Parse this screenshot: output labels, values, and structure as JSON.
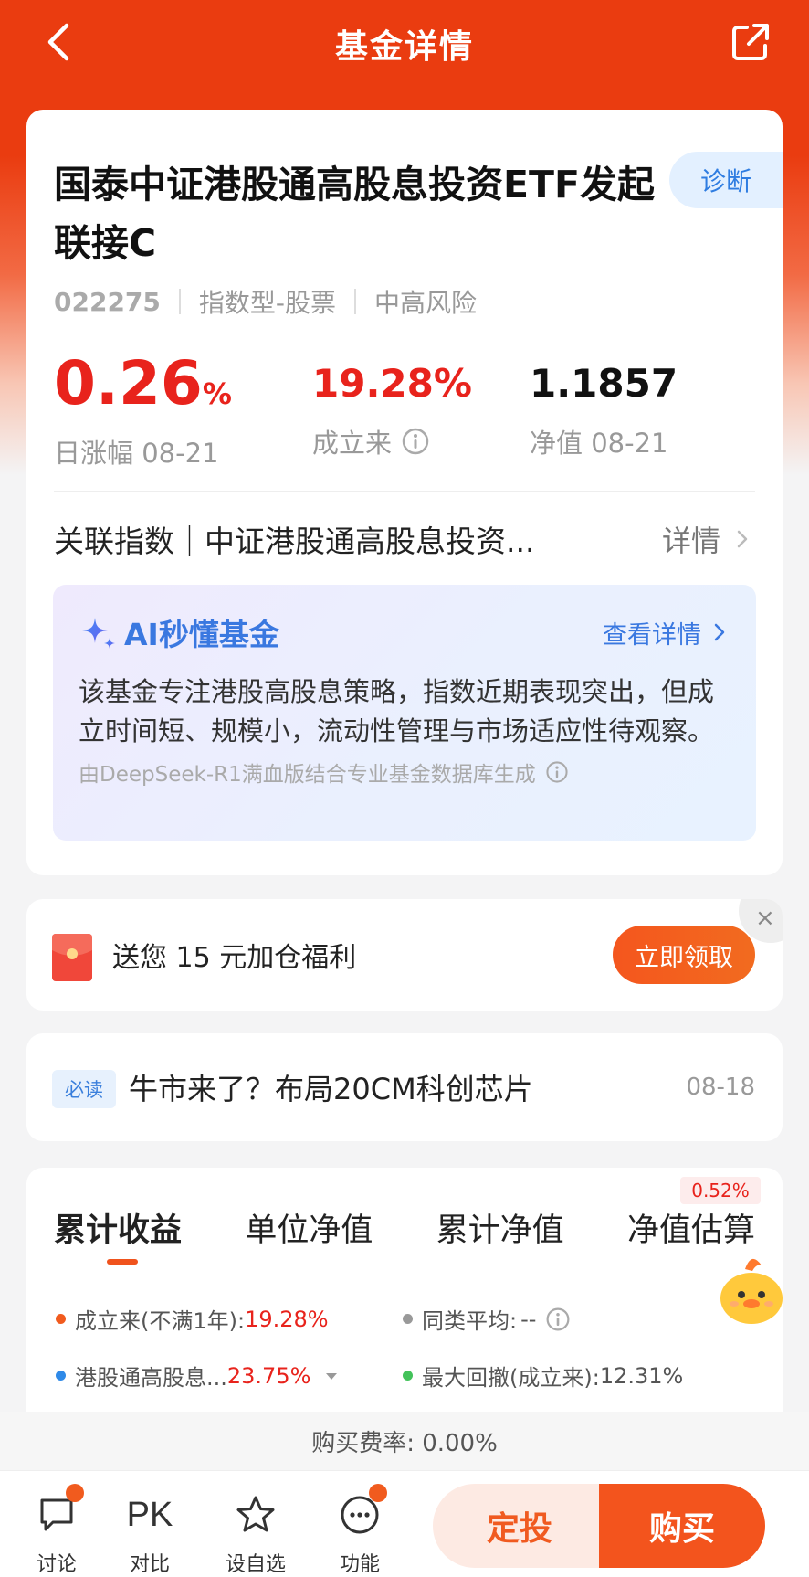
{
  "header": {
    "title": "基金详情"
  },
  "fund": {
    "name": "国泰中证港股通高股息投资ETF发起联接C",
    "code": "022275",
    "type": "指数型-股票",
    "risk": "中高风险",
    "diagnose_label": "诊断"
  },
  "stats": {
    "daily_change": "0.26",
    "daily_change_unit": "%",
    "daily_change_label": "日涨幅 08-21",
    "since_inception": "19.28%",
    "since_inception_label": "成立来",
    "nav": "1.1857",
    "nav_label": "净值 08-21"
  },
  "index": {
    "text": "关联指数｜中证港股通高股息投资...",
    "detail_label": "详情"
  },
  "ai": {
    "title": "AI秒懂基金",
    "link_label": "查看详情",
    "summary": "该基金专注港股高股息策略，指数近期表现突出，但成立时间短、规模小，流动性管理与市场适应性待观察。",
    "source": "由DeepSeek-R1满血版结合专业基金数据库生成"
  },
  "promo": {
    "text": "送您 15 元加仓福利",
    "button_label": "立即领取",
    "close_label": "×"
  },
  "news": {
    "tag": "必读",
    "title": "牛市来了？布局20CM科创芯片",
    "date": "08-18"
  },
  "performance": {
    "tabs": [
      "累计收益",
      "单位净值",
      "累计净值",
      "净值估算"
    ],
    "estimate_badge": "0.52%",
    "legend": {
      "fund_label": "成立来(不满1年):",
      "fund_value": "19.28%",
      "peer_label": "同类平均:",
      "peer_value": "--",
      "index_label": "港股通高股息...",
      "index_value": "23.75%",
      "drawdown_label": "最大回撤(成立来):",
      "drawdown_value": "12.31%"
    },
    "colors": {
      "fund": "#f15b1e",
      "peer": "#999999",
      "index": "#2f8ae8",
      "drawdown": "#43c25a"
    }
  },
  "fee": {
    "text": "购买费率: 0.00%"
  },
  "bottom": {
    "discuss_label": "讨论",
    "pk_icon_text": "PK",
    "compare_label": "对比",
    "watch_label": "设自选",
    "func_label": "功能",
    "dingtou_label": "定投",
    "buy_label": "购买"
  }
}
